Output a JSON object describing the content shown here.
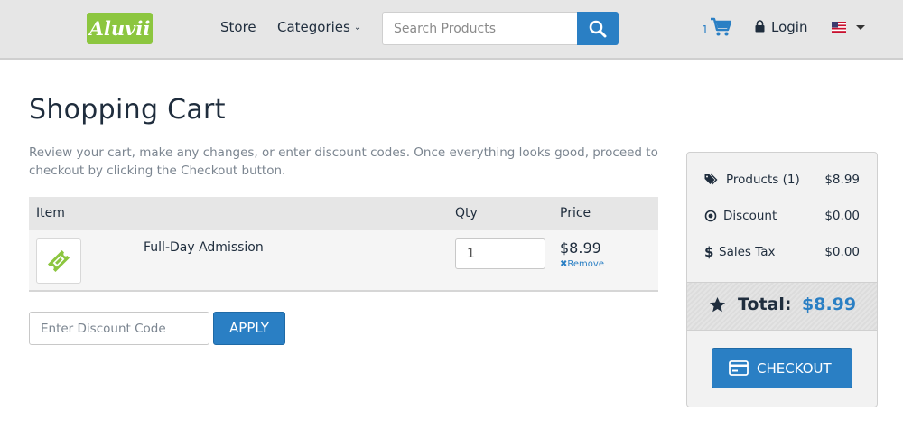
{
  "header": {
    "logo_text": "Aluvii",
    "nav": {
      "store": "Store",
      "categories": "Categories"
    },
    "search": {
      "placeholder": "Search Products",
      "value": ""
    },
    "cart_count": "1",
    "login": "Login",
    "icons": {
      "search": "search-icon",
      "cart": "cart-icon",
      "lock": "lock-icon",
      "flag": "us-flag-icon",
      "caret": "caret-down-icon"
    }
  },
  "main": {
    "title": "Shopping Cart",
    "intro": "Review your cart, make any changes, or enter discount codes. Once everything looks good, proceed to checkout by clicking the Checkout button.",
    "table": {
      "columns": [
        "Item",
        "Qty",
        "Price"
      ],
      "rows": [
        {
          "name": "Full-Day Admission",
          "qty": "1",
          "price": "$8.99",
          "remove": "Remove",
          "icon": "ticket-icon"
        }
      ]
    },
    "discount": {
      "placeholder": "Enter Discount Code",
      "apply": "APPLY"
    }
  },
  "summary": {
    "products_label": "Products (1)",
    "products_value": "$8.99",
    "discount_label": "Discount",
    "discount_value": "$0.00",
    "tax_label": "Sales Tax",
    "tax_value": "$0.00",
    "total_label": "Total:",
    "total_value": "$8.99",
    "checkout": "CHECKOUT"
  },
  "colors": {
    "accent": "#2a7fc4",
    "brand_green": "#8cc63f",
    "header_bg": "#e6e6e6",
    "text": "#1f2d3d"
  }
}
